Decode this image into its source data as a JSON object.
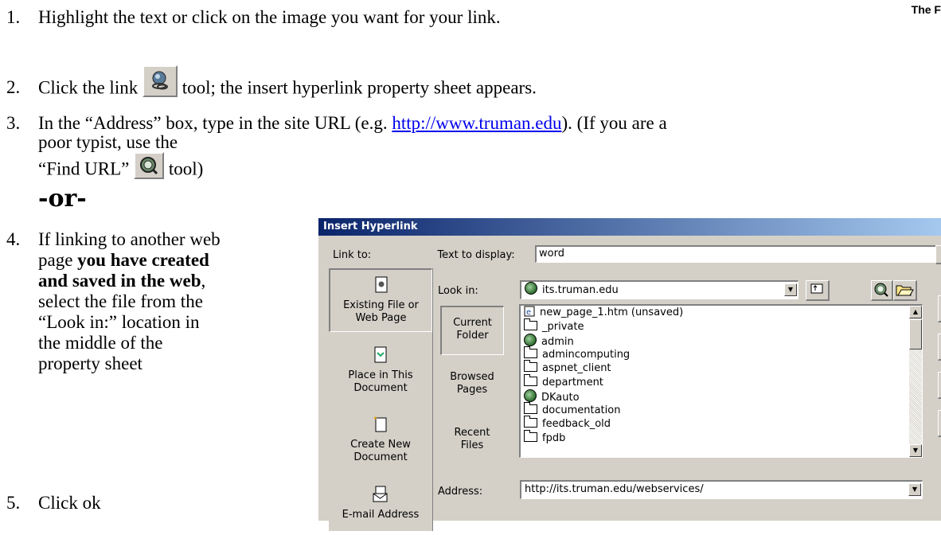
{
  "header": {
    "corner_text": "The F"
  },
  "steps": [
    {
      "num": "1.",
      "text": "Highlight the text or click on the image you want for your link."
    },
    {
      "num": "2.",
      "text_before": "Click the link",
      "text_after": "tool; the insert hyperlink property sheet appears."
    },
    {
      "num": "3.",
      "text_before": "In the “Address”  box, type in the site URL (e.g. ",
      "link": "http://www.truman.edu",
      "text_after": ").  (If you are a",
      "cont1": "poor typist, use the",
      "cont2_before": "“Find URL”",
      "cont2_after": "tool)"
    },
    {
      "or": "-or-"
    },
    {
      "num": "4.",
      "lines": [
        "If linking to another web",
        "page ",
        "and saved in the web",
        "select the file from the",
        "“Look in:” location in",
        "the middle of the",
        "property sheet"
      ],
      "bold1": "you have created",
      "comma": ","
    },
    {
      "num": "5.",
      "text": "Click ok"
    }
  ],
  "dialog": {
    "title": "Insert Hyperlink",
    "link_to_label": "Link to:",
    "text_to_display_label": "Text to display:",
    "text_to_display_value": "word",
    "look_in_label": "Look in:",
    "look_in_value": "its.truman.edu",
    "address_label": "Address:",
    "address_value": "http://its.truman.edu/webservices/",
    "nav": [
      {
        "line1": "Existing File or",
        "line2": "Web Page"
      },
      {
        "line1": "Place in This",
        "line2": "Document"
      },
      {
        "line1": "Create New",
        "line2": "Document"
      },
      {
        "line1": "E-mail Address",
        "line2": ""
      }
    ],
    "pane_buttons": [
      {
        "line1": "Current",
        "line2": "Folder"
      },
      {
        "line1": "Browsed",
        "line2": "Pages"
      },
      {
        "line1": "Recent",
        "line2": "Files"
      }
    ],
    "files": [
      {
        "name": "new_page_1.htm (unsaved)",
        "icon": "ie-document-icon"
      },
      {
        "name": "_private",
        "icon": "folder-icon"
      },
      {
        "name": "admin",
        "icon": "web-folder-icon"
      },
      {
        "name": "admincomputing",
        "icon": "folder-icon"
      },
      {
        "name": "aspnet_client",
        "icon": "folder-icon"
      },
      {
        "name": "department",
        "icon": "folder-icon"
      },
      {
        "name": "DKauto",
        "icon": "web-folder-icon"
      },
      {
        "name": "documentation",
        "icon": "folder-icon"
      },
      {
        "name": "feedback_old",
        "icon": "folder-icon"
      },
      {
        "name": "fpdb",
        "icon": "folder-icon"
      }
    ]
  }
}
